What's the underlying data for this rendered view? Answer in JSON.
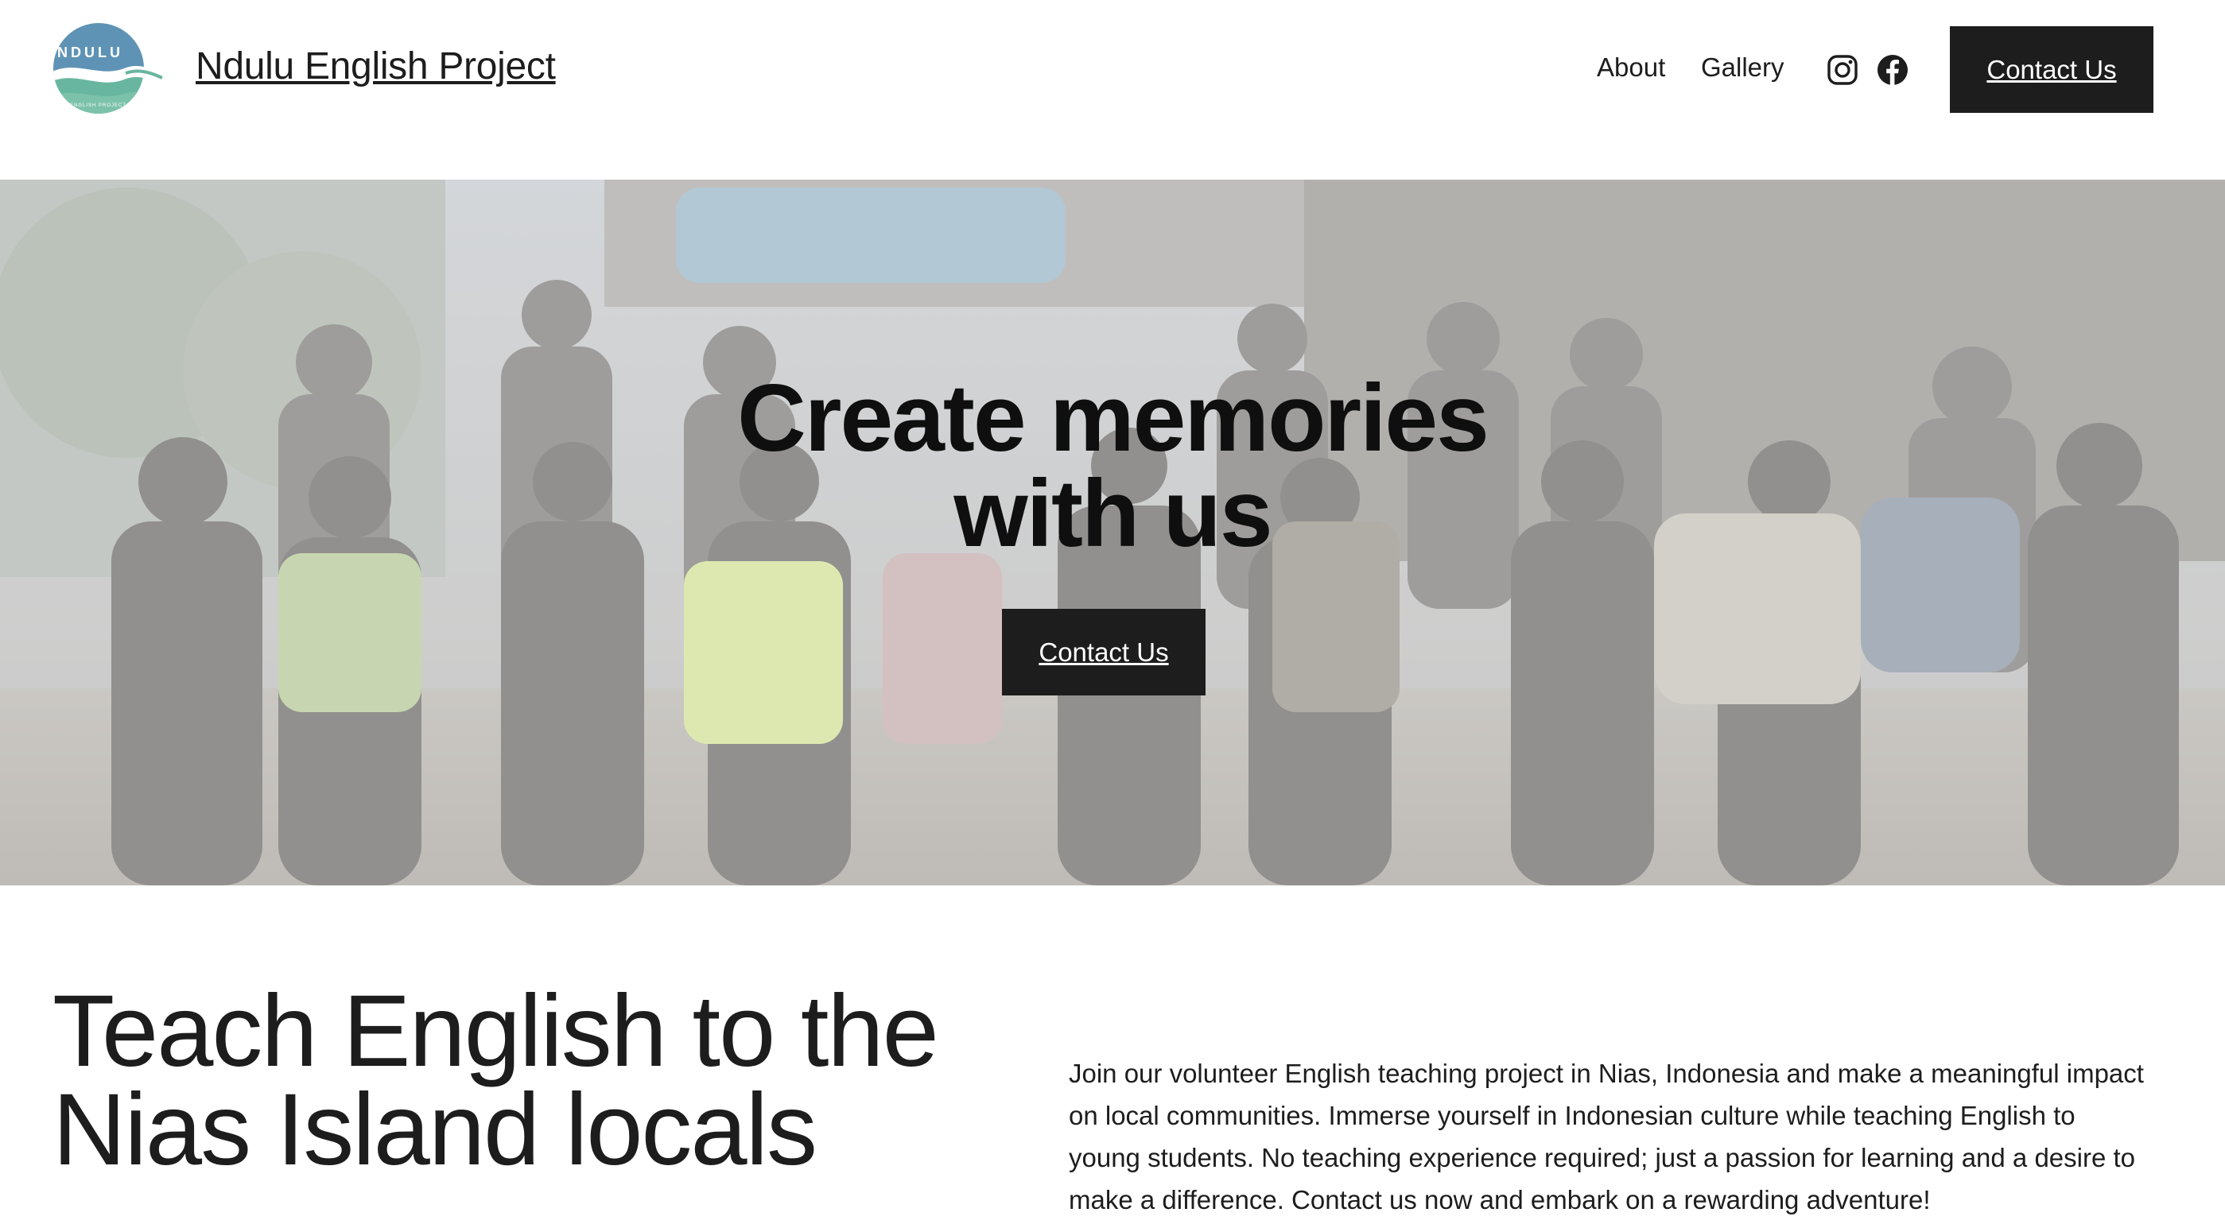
{
  "header": {
    "logo_text": "NDULU",
    "logo_subtext": "ENGLISH PROJECT",
    "site_title": "Ndulu English Project",
    "nav": [
      {
        "label": "About"
      },
      {
        "label": "Gallery"
      }
    ],
    "social": [
      {
        "icon": "instagram-icon"
      },
      {
        "icon": "facebook-icon"
      }
    ],
    "cta_label": "Contact Us"
  },
  "hero": {
    "title_line1": "Create memories",
    "title_line2": "with us",
    "cta_label": "Contact Us"
  },
  "intro": {
    "heading_line1": "Teach English to the",
    "heading_line2": "Nias Island locals",
    "body": "Join our volunteer English teaching project in Nias, Indonesia and make a meaningful impact on local communities. Immerse yourself in Indonesian culture while teaching English to young students. No teaching experience required; just a passion for learning and a desire to make a difference. Contact us now and embark on a rewarding adventure!"
  },
  "colors": {
    "button_bg": "#1d1d1d",
    "button_text": "#ffffff",
    "logo_blue": "#5e93b5",
    "logo_teal": "#69b6a0",
    "text": "#1d1d1d",
    "background": "#ffffff"
  }
}
